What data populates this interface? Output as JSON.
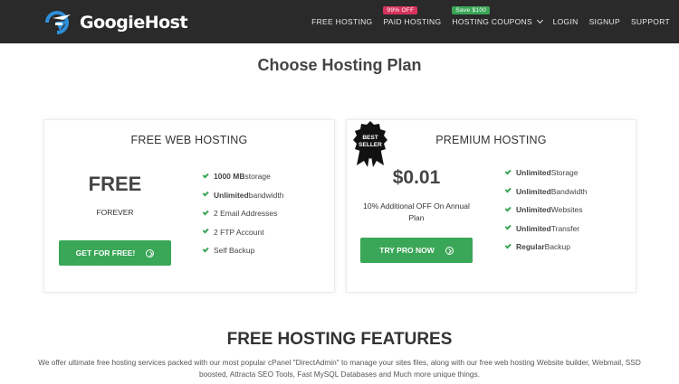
{
  "header": {
    "logo_text": "GoogieHost",
    "nav": [
      {
        "label": "FREE HOSTING"
      },
      {
        "label": "PAID HOSTING",
        "badge": "99% OFF"
      },
      {
        "label": "HOSTING COUPONS",
        "badge": "Save $100"
      },
      {
        "label": "LOGIN"
      },
      {
        "label": "SIGNUP"
      },
      {
        "label": "SUPPORT"
      }
    ]
  },
  "page_title": "Choose Hosting Plan",
  "plans": {
    "free": {
      "title": "FREE WEB HOSTING",
      "price": "FREE",
      "period": "FOREVER",
      "features": [
        {
          "bold": "1000 MB",
          "rest": " storage"
        },
        {
          "bold": "Unlimited",
          "rest": " bandwidth"
        },
        {
          "bold": "",
          "rest": "2 Email Addresses"
        },
        {
          "bold": "",
          "rest": "2 FTP Account"
        },
        {
          "bold": "",
          "rest": "Self Backup"
        }
      ],
      "button": "GET FOR FREE!"
    },
    "premium": {
      "title": "PREMIUM HOSTING",
      "seal_text": "BEST SELLER",
      "price": "$0.01",
      "note": "10% Additional OFF On Annual Plan",
      "features": [
        {
          "bold": "Unlimited",
          "rest": " Storage"
        },
        {
          "bold": "Unlimited",
          "rest": " Bandwidth"
        },
        {
          "bold": "Unlimited",
          "rest": " Websites"
        },
        {
          "bold": "Unlimited",
          "rest": " Transfer"
        },
        {
          "bold": "Regular",
          "rest": " Backup"
        }
      ],
      "button": "TRY PRO NOW"
    }
  },
  "features_section": {
    "title": "FREE HOSTING FEATURES",
    "description": "We offer ultimate free hosting services packed with our most popular cPanel \"DirectAdmin\" to manage your sites files, along with our free web hosting Website builder, Webmail, SSD boosted, Attracta SEO Tools, Fast MySQL Databases and Much more unique things."
  },
  "colors": {
    "header_bg": "#2a2a2a",
    "accent_green": "#3aa657",
    "badge_red": "#d6335d",
    "logo_blue": "#2f8fd8"
  }
}
